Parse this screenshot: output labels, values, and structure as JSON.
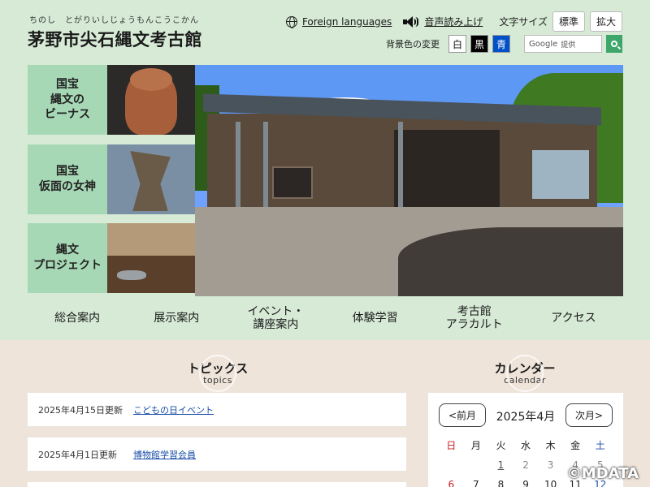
{
  "header": {
    "ruby": "ちのし　とがりいしじょうもんこうこかん",
    "title": "茅野市尖石縄文考古館",
    "foreign_languages": "Foreign languages",
    "read_aloud": "音声読み上げ",
    "font_size_label": "文字サイズ",
    "font_standard": "標準",
    "font_large": "拡大",
    "bg_color_label": "背景色の変更",
    "bg_white": "白",
    "bg_black": "黒",
    "bg_blue": "青",
    "search_placeholder": "提供",
    "search_brand": "Google"
  },
  "tiles": [
    {
      "label_lines": [
        "国宝",
        "縄文の",
        "ビーナス"
      ]
    },
    {
      "label_lines": [
        "国宝",
        "仮面の女神"
      ]
    },
    {
      "label_lines": [
        "縄文",
        "プロジェクト"
      ]
    }
  ],
  "nav": {
    "items": [
      {
        "line1": "総合案内",
        "line2": ""
      },
      {
        "line1": "展示案内",
        "line2": ""
      },
      {
        "line1": "イベント・",
        "line2": "講座案内"
      },
      {
        "line1": "体験学習",
        "line2": ""
      },
      {
        "line1": "考古館",
        "line2": "アラカルト"
      },
      {
        "line1": "アクセス",
        "line2": ""
      }
    ]
  },
  "topics": {
    "title_jp": "トピックス",
    "title_en": "topics",
    "items": [
      {
        "date": "2025年4月15日更新",
        "link": "こどもの日イベント"
      },
      {
        "date": "2025年4月1日更新",
        "link": "博物館学習会員"
      }
    ]
  },
  "calendar": {
    "title_jp": "カレンダー",
    "title_en": "calendar",
    "prev": "<前月",
    "next": "次月>",
    "month": "2025年4月",
    "weekdays": [
      "日",
      "月",
      "火",
      "水",
      "木",
      "金",
      "土"
    ],
    "week1": [
      "",
      "",
      "1",
      "2",
      "3",
      "4",
      "5"
    ],
    "week2": [
      "6",
      "7",
      "8",
      "9",
      "10",
      "11",
      "12"
    ]
  },
  "copyright": "©MDATA",
  "colors": {
    "header_bg": "#d6ead6",
    "tile_bg": "#a7d8b6",
    "lower_bg": "#efe4da",
    "search_button": "#3ea66b",
    "link": "#1a4fa8",
    "sunday": "#c82020",
    "saturday": "#1a4fa8"
  }
}
